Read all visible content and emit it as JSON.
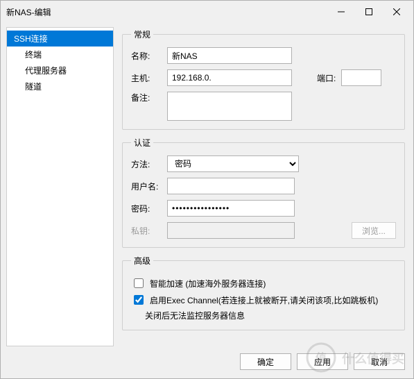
{
  "window": {
    "title": "新NAS-编辑"
  },
  "sidebar": {
    "items": [
      {
        "label": "SSH连接",
        "selected": true
      },
      {
        "label": "终端"
      },
      {
        "label": "代理服务器"
      },
      {
        "label": "隧道"
      }
    ]
  },
  "general": {
    "legend": "常规",
    "name_label": "名称:",
    "name_value": "新NAS",
    "host_label": "主机:",
    "host_value": "192.168.0.",
    "port_label": "端口:",
    "port_value": "",
    "note_label": "备注:",
    "note_value": ""
  },
  "auth": {
    "legend": "认证",
    "method_label": "方法:",
    "method_value": "密码",
    "user_label": "用户名:",
    "user_value": "",
    "password_label": "密码:",
    "password_value": "••••••••••••••••",
    "privkey_label": "私钥:",
    "browse_label": "浏览..."
  },
  "advanced": {
    "legend": "高级",
    "smart_accel_label": "智能加速 (加速海外服务器连接)",
    "smart_accel_checked": false,
    "exec_channel_label": "启用Exec Channel(若连接上就被断开,请关闭该项,比如跳板机)",
    "exec_channel_checked": true,
    "exec_channel_hint": "关闭后无法监控服务器信息"
  },
  "footer": {
    "ok": "确定",
    "apply": "应用",
    "cancel": "取消"
  },
  "watermark": "值a什么值得买"
}
